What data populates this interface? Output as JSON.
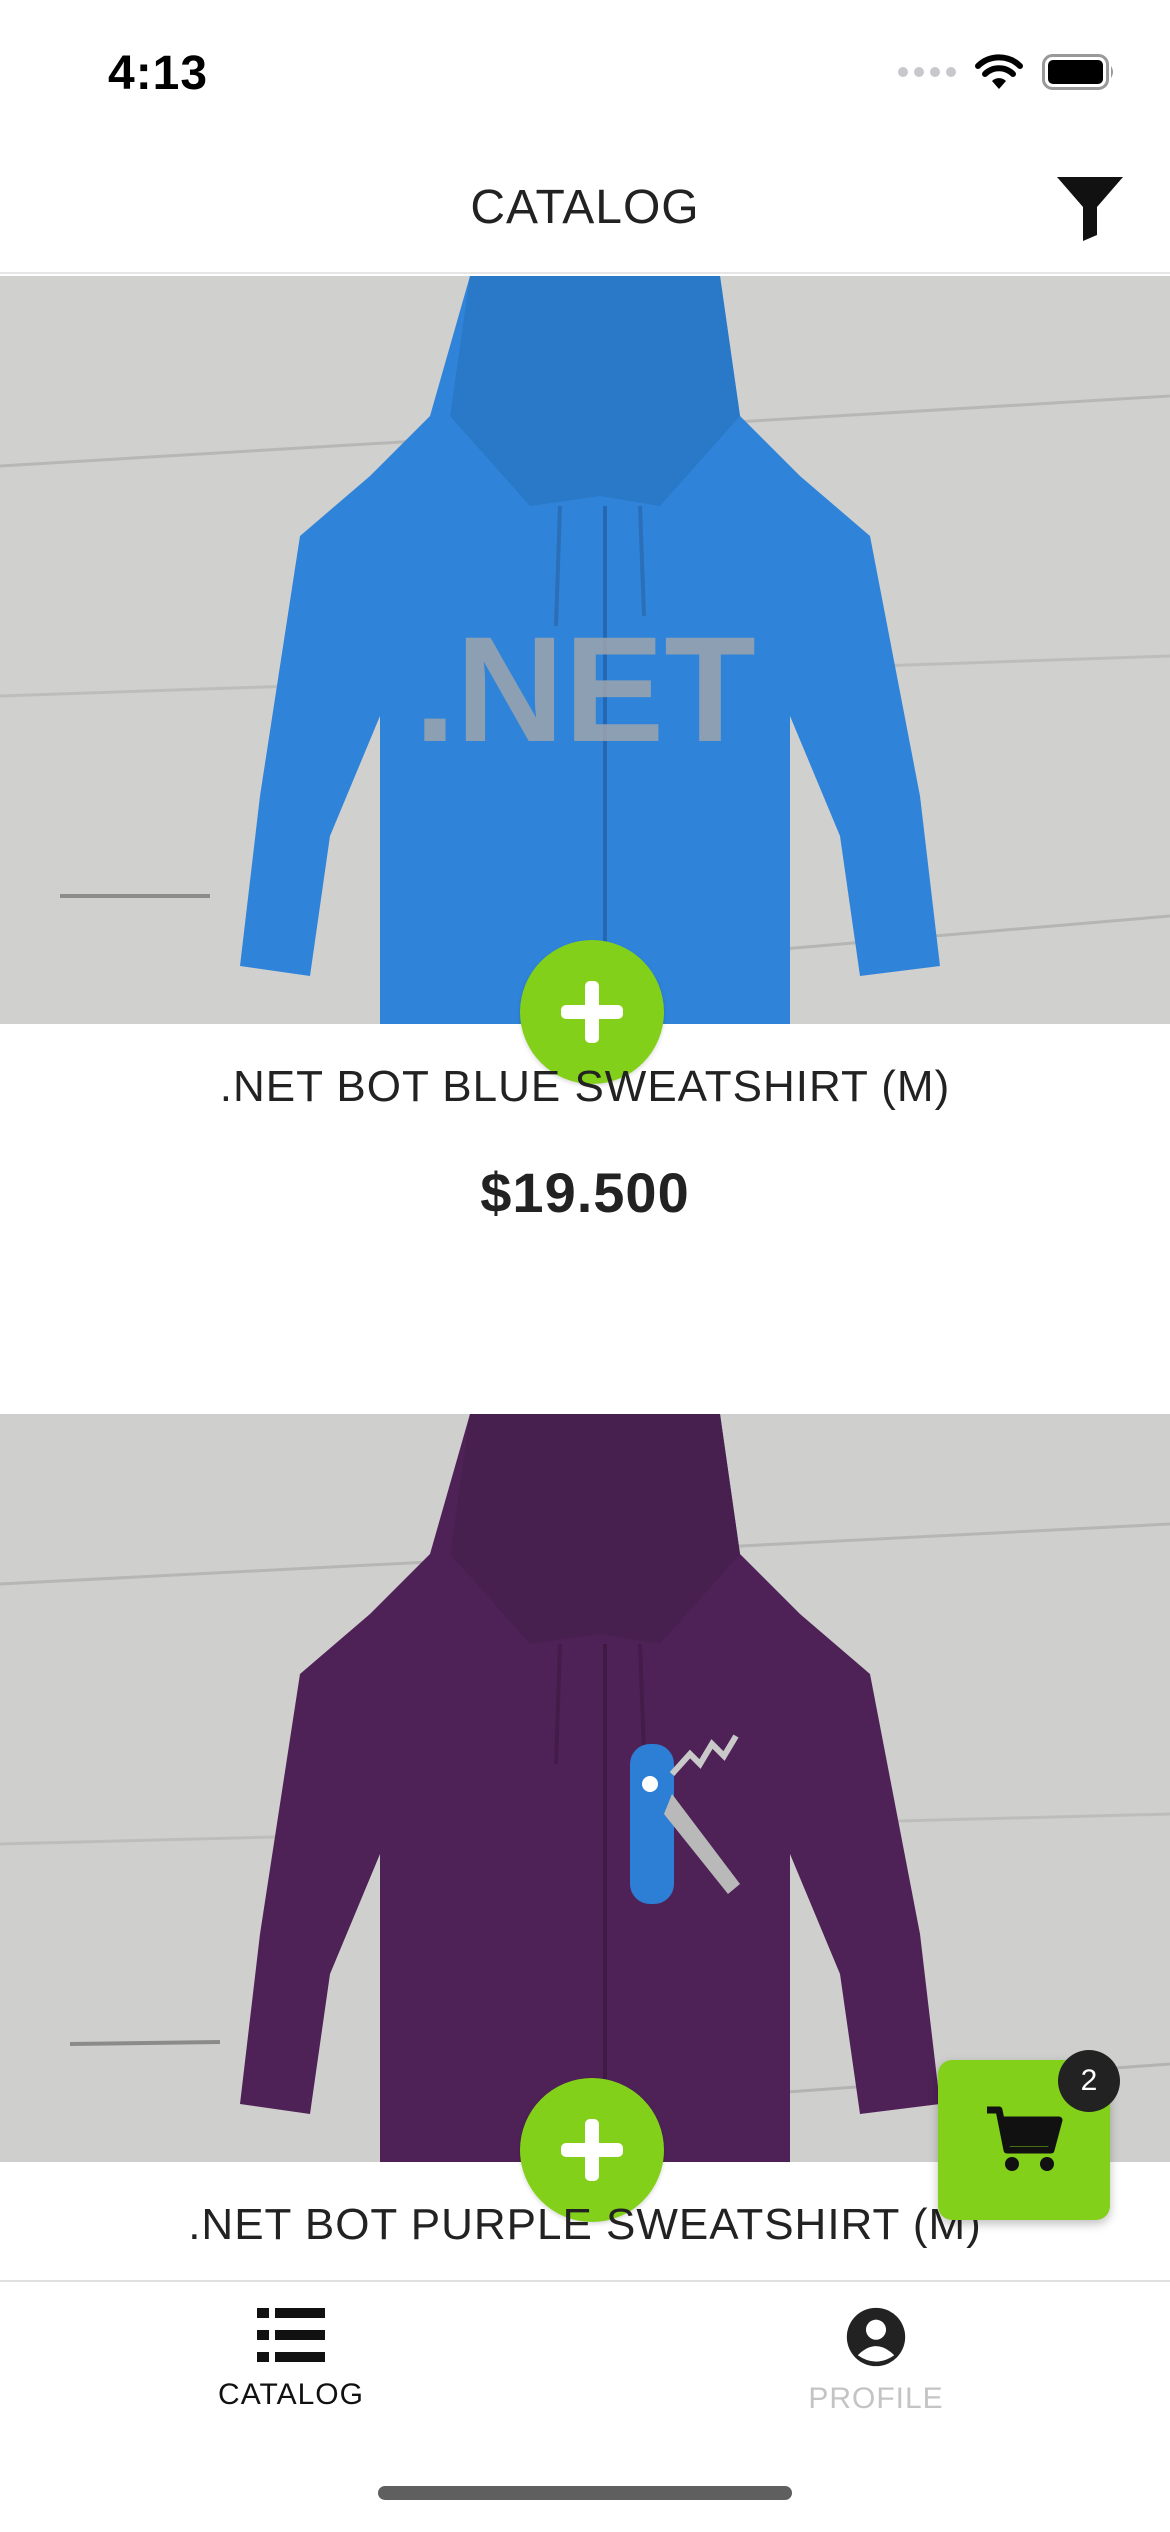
{
  "status_bar": {
    "time": "4:13",
    "icons": [
      "signal-dots-icon",
      "wifi-icon",
      "battery-icon"
    ]
  },
  "header": {
    "title": "CATALOG",
    "filter_icon": "filter-icon"
  },
  "products": [
    {
      "name": ".NET BOT BLUE SWEATSHIRT (M)",
      "price": "$19.500",
      "image": "blue hoodie with .NET print",
      "color": "#2d82d8"
    },
    {
      "name": ".NET BOT PURPLE SWEATSHIRT (M)",
      "image": "purple hoodie with knife print",
      "color": "#4e2256"
    }
  ],
  "cart": {
    "count": "2",
    "icon": "cart-icon"
  },
  "tabs": [
    {
      "label": "CATALOG",
      "icon": "list-icon",
      "active": true
    },
    {
      "label": "PROFILE",
      "icon": "user-icon",
      "active": false
    }
  ],
  "colors": {
    "accent": "#83d01b",
    "text": "#222222",
    "inactive": "#c4c4c4"
  }
}
